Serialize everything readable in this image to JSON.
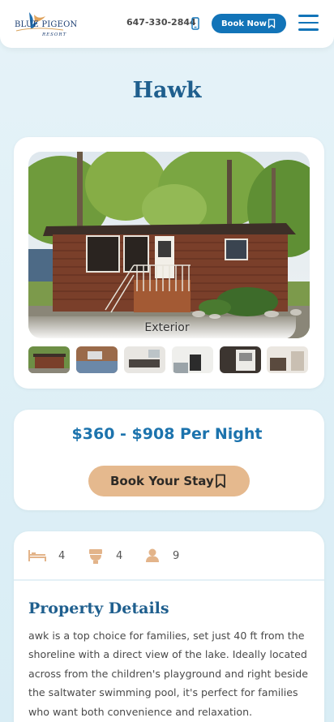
{
  "header": {
    "logo_text": "BLUE PIGEON",
    "logo_sub": "RESORT",
    "phone": "647-330-2844",
    "book_now_label": "Book Now"
  },
  "page": {
    "title": "Hawk"
  },
  "gallery": {
    "caption": "Exterior",
    "thumbnails": [
      "exterior",
      "living-room",
      "dining",
      "kitchen",
      "bedroom",
      "room"
    ]
  },
  "pricing": {
    "price_text": "$360 - $908 Per Night",
    "book_stay_label": "Book Your Stay"
  },
  "amenities": {
    "beds": "4",
    "baths": "4",
    "guests": "9",
    "icons": [
      "bed-icon",
      "toilet-icon",
      "guest-icon"
    ]
  },
  "details": {
    "title": "Property Details",
    "text": "awk is a top choice for families, set just 40 ft from the shoreline with a direct view of the lake. Ideally located across from the children's playground and right beside the saltwater swimming pool, it's perfect for families who want both convenience and relaxation."
  },
  "colors": {
    "brand_blue": "#1274b8",
    "title_blue": "#1f5f8e",
    "book_stay_tan": "#e5b98e",
    "background": "#e6f3f8"
  }
}
